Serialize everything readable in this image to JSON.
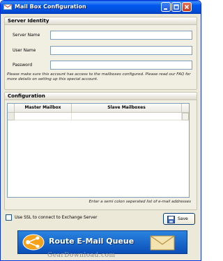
{
  "window": {
    "title": "Mail Box Configuration"
  },
  "server_identity": {
    "header": "Server Identity",
    "fields": [
      {
        "label": "Server Name",
        "value": ""
      },
      {
        "label": "User Name",
        "value": ""
      },
      {
        "label": "Password",
        "value": ""
      }
    ],
    "note": "Please make sure this account has access to the mailboxes configured. Please read our FAQ for more details on setting up this special account."
  },
  "configuration": {
    "header": "Configuration",
    "columns": [
      "Master Mailbox",
      "Slave Mailboxes"
    ],
    "rows": [],
    "hint": "Enter a semi colon seperated list of e-mail addresses"
  },
  "ssl": {
    "label": "Use SSL to connect to Exchange Server",
    "checked": false
  },
  "save_button": {
    "label": "Save"
  },
  "banner": {
    "text": "Route E-Mail Queue"
  },
  "watermark": "GearDownload.com"
}
